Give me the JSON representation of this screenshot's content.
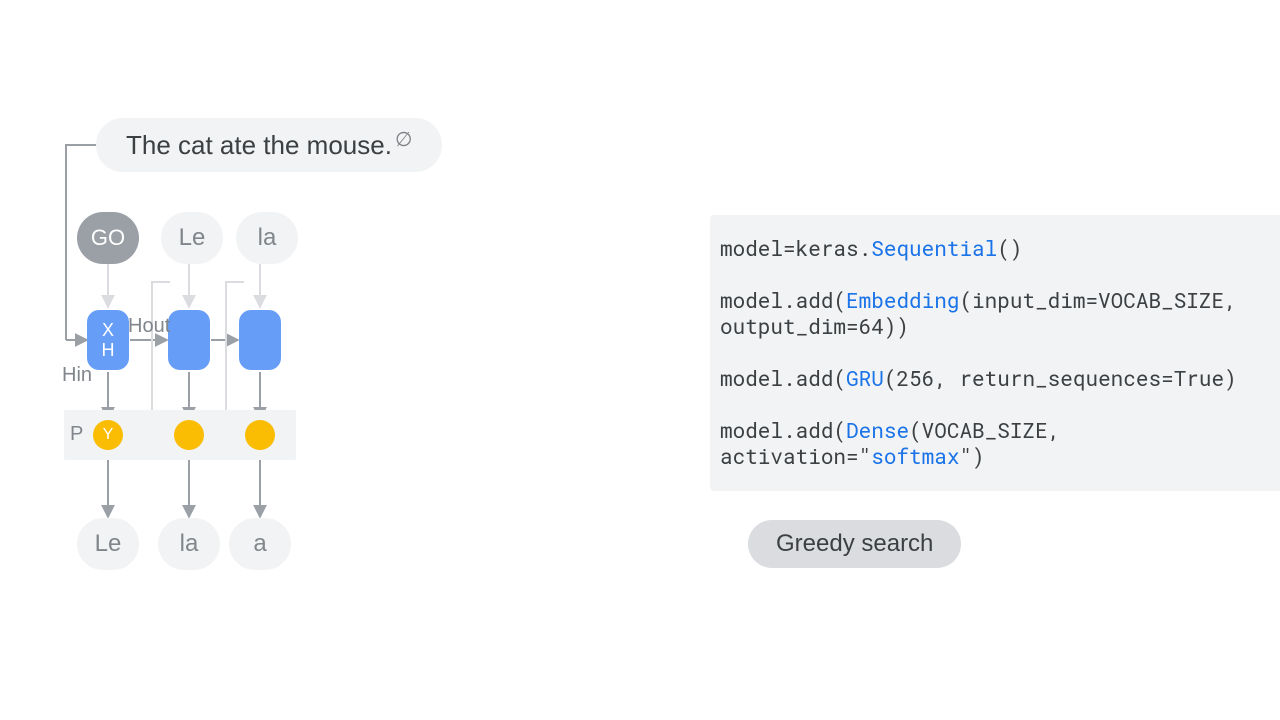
{
  "sentence": "The cat ate the mouse.",
  "eos_glyph": "∅",
  "inputs": [
    "GO",
    "Le",
    "la"
  ],
  "outputs": [
    "Le",
    "la",
    "a"
  ],
  "cell_label_x": "X",
  "cell_label_h": "H",
  "label_hout": "Hout",
  "label_hin": "Hin",
  "label_p": "P",
  "label_y": "Y",
  "greedy": "Greedy search",
  "code": {
    "l1_a": "model=keras.",
    "l1_b": "Sequential",
    "l1_c": "()",
    "l2_a": "model.add(",
    "l2_b": "Embedding",
    "l2_c": "(input_dim=VOCAB_SIZE, output_dim=64))",
    "l3_a": "model.add(",
    "l3_b": "GRU",
    "l3_c": "(256, return_sequences=True)",
    "l4_a": "model.add(",
    "l4_b": "Dense",
    "l4_c": "(VOCAB_SIZE, activation=\"",
    "l4_d": "softmax",
    "l4_e": "\")"
  },
  "colors": {
    "blue": "#669df6",
    "yellow": "#fbbc04",
    "grey": "#9aa0a6",
    "code_kw": "#1a73e8"
  }
}
